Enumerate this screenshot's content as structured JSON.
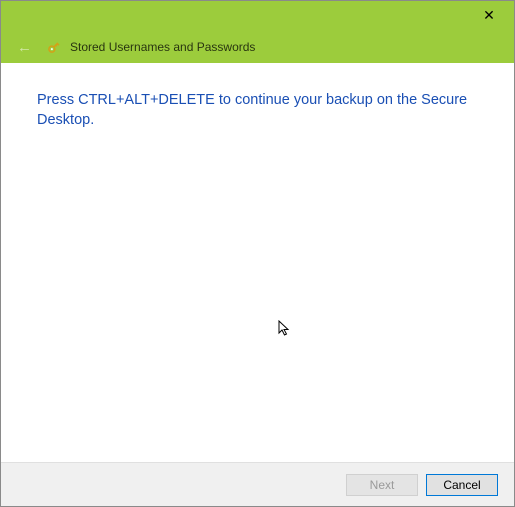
{
  "window": {
    "close_symbol": "✕"
  },
  "header": {
    "back_symbol": "←",
    "title": "Stored Usernames and Passwords"
  },
  "content": {
    "instruction": "Press CTRL+ALT+DELETE to continue your backup on the Secure Desktop."
  },
  "footer": {
    "next_label": "Next",
    "cancel_label": "Cancel"
  }
}
